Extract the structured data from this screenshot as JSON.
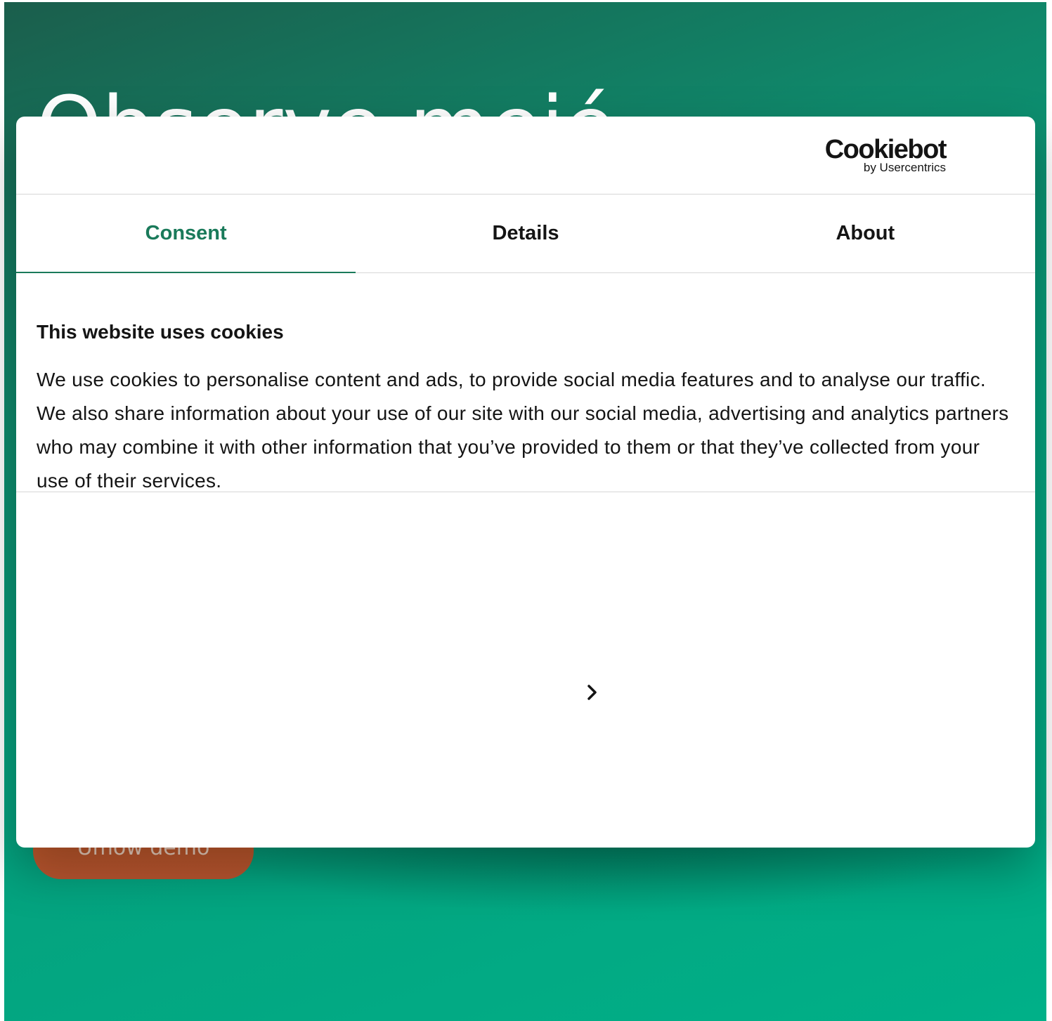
{
  "background": {
    "hero_title": "Observe mejé",
    "demo_button_label": "Umów demo"
  },
  "dialog": {
    "logo": {
      "brand": "Cookiebot",
      "byline": "by Usercentrics"
    },
    "tabs": [
      {
        "label": "Consent",
        "active": true
      },
      {
        "label": "Details",
        "active": false
      },
      {
        "label": "About",
        "active": false
      }
    ],
    "heading": "This website uses cookies",
    "body": "We use cookies to personalise content and ads, to provide social media features and to analyse our traffic. We also share information about your use of our site with our social media, advertising and analytics partners who may combine it with other information that you’ve provided to them or that they’ve collected from your use of their services.",
    "chevron_icon": "chevron-right-icon"
  },
  "colors": {
    "accent": "#1a7a5a",
    "text": "#141414",
    "divider": "#d6d6d6",
    "page_green": "#00b088",
    "demo_orange": "#c85a2c"
  }
}
